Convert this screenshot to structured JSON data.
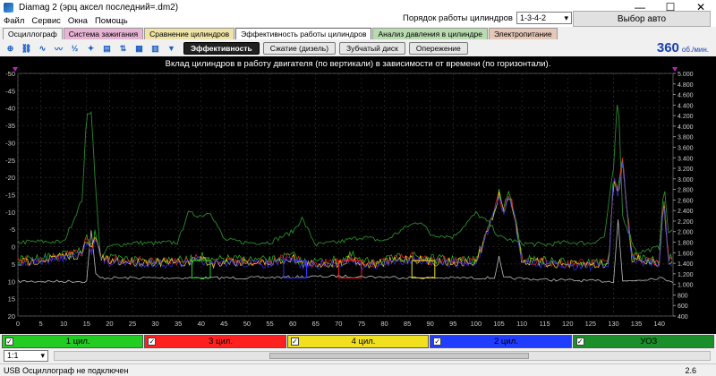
{
  "window": {
    "title": "Diamag 2 (эрц аксел последний=.dm2)",
    "minimize": "—",
    "maximize": "☐",
    "close": "✕"
  },
  "menu": [
    "Файл",
    "Сервис",
    "Окна",
    "Помощь"
  ],
  "order": {
    "label": "Порядок работы цилиндров",
    "value": "1-3-4-2",
    "spin_value": "1"
  },
  "auto_button": "Выбор авто",
  "tabs": [
    {
      "label": "Осциллограф",
      "color": "#f3f3f3"
    },
    {
      "label": "Система зажигания",
      "color": "#e8b4d6"
    },
    {
      "label": "Сравнение цилиндров",
      "color": "#efe3a6"
    },
    {
      "label": "Эффективность работы цилиндров",
      "color": "#ffffff"
    },
    {
      "label": "Анализ давления в цилиндре",
      "color": "#b8dcb0"
    },
    {
      "label": "Электропитание",
      "color": "#e6c8b8"
    }
  ],
  "subtabs": [
    "Эффективность",
    "Сжатие (дизель)",
    "Зубчатый диск",
    "Опережение"
  ],
  "rpm": {
    "value": "360",
    "unit": "об./мин."
  },
  "chart_data": {
    "type": "line",
    "title": "Вклад цилиндров в работу двигателя (по вертикали) в зависимости от времени (по горизонтали).",
    "x_ticks": [
      "0",
      "5",
      "10",
      "15",
      "20",
      "25",
      "30",
      "35",
      "40",
      "45",
      "50",
      "55",
      "60",
      "65",
      "70",
      "75",
      "80",
      "85",
      "90",
      "95",
      "100",
      "105",
      "110",
      "115",
      "120",
      "125",
      "130",
      "135",
      "140"
    ],
    "y_left_ticks": [
      "-50",
      "-45",
      "-40",
      "-35",
      "-30",
      "-25",
      "-20",
      "-15",
      "-10",
      "-5",
      "0",
      "5",
      "10",
      "15",
      "20"
    ],
    "y_right_ticks": [
      "5.000",
      "4.800",
      "4.600",
      "4.400",
      "4.200",
      "4.000",
      "3.800",
      "3.600",
      "3.400",
      "3.200",
      "3.000",
      "2.800",
      "2.600",
      "2.400",
      "2.200",
      "2.000",
      "1.800",
      "1.600",
      "1.400",
      "1.200",
      "1.000",
      "800",
      "600",
      "400"
    ],
    "xlim": [
      0,
      143
    ],
    "ylim_left": [
      -50,
      20
    ],
    "ylim_right": [
      400,
      5000
    ],
    "grid": true,
    "colors": {
      "cyl1": "#22cc22",
      "cyl2": "#ff2020",
      "cyl3": "#f0e020",
      "cyl4": "#3030ff",
      "rpm": "#2a8a2a",
      "ignition": "#bbbbbb",
      "background": "#000000"
    },
    "series_rpm_right_axis": [
      [
        0,
        1800
      ],
      [
        5,
        1810
      ],
      [
        10,
        1800
      ],
      [
        14,
        2600
      ],
      [
        15,
        4200
      ],
      [
        16,
        4300
      ],
      [
        17,
        2800
      ],
      [
        18,
        1500
      ],
      [
        20,
        1720
      ],
      [
        25,
        1790
      ],
      [
        30,
        1780
      ],
      [
        35,
        1800
      ],
      [
        37,
        2350
      ],
      [
        40,
        2300
      ],
      [
        42,
        2380
      ],
      [
        45,
        1850
      ],
      [
        50,
        1790
      ],
      [
        55,
        1800
      ],
      [
        60,
        2000
      ],
      [
        62,
        2250
      ],
      [
        65,
        1750
      ],
      [
        70,
        1800
      ],
      [
        75,
        1900
      ],
      [
        80,
        1820
      ],
      [
        85,
        2100
      ],
      [
        88,
        2200
      ],
      [
        90,
        1950
      ],
      [
        95,
        1900
      ],
      [
        100,
        2350
      ],
      [
        103,
        2150
      ],
      [
        105,
        1900
      ],
      [
        110,
        1780
      ],
      [
        115,
        1750
      ],
      [
        120,
        1800
      ],
      [
        125,
        1780
      ],
      [
        128,
        1900
      ],
      [
        130,
        3200
      ],
      [
        131,
        4650
      ],
      [
        132,
        2300
      ],
      [
        135,
        1600
      ],
      [
        140,
        1700
      ],
      [
        141,
        2900
      ],
      [
        142,
        2000
      ]
    ],
    "series_ignition_left_axis": [
      [
        0,
        10
      ],
      [
        15,
        10
      ],
      [
        16,
        -5
      ],
      [
        17,
        8
      ],
      [
        18,
        9
      ],
      [
        30,
        9
      ],
      [
        50,
        9
      ],
      [
        70,
        8.5
      ],
      [
        90,
        9
      ],
      [
        104,
        9
      ],
      [
        105,
        3
      ],
      [
        106,
        9
      ],
      [
        115,
        9.5
      ],
      [
        130,
        10
      ],
      [
        131,
        -8
      ],
      [
        132,
        10
      ],
      [
        140,
        9
      ],
      [
        143,
        10
      ]
    ],
    "cylinder_overlay": [
      [
        0,
        4.5
      ],
      [
        14,
        2
      ],
      [
        15,
        -2
      ],
      [
        16,
        1
      ],
      [
        17,
        -4
      ],
      [
        18,
        3
      ],
      [
        20,
        4
      ],
      [
        37,
        4.5
      ],
      [
        40,
        3
      ],
      [
        42,
        5
      ],
      [
        45,
        4
      ],
      [
        55,
        4.5
      ],
      [
        60,
        3
      ],
      [
        62,
        5
      ],
      [
        70,
        4.5
      ],
      [
        73,
        3
      ],
      [
        75,
        5
      ],
      [
        80,
        4.5
      ],
      [
        86,
        3
      ],
      [
        89,
        4
      ],
      [
        100,
        4.5
      ],
      [
        104,
        -10
      ],
      [
        105,
        -15
      ],
      [
        106,
        -10
      ],
      [
        107,
        -15
      ],
      [
        108,
        -12
      ],
      [
        110,
        4
      ],
      [
        120,
        5
      ],
      [
        129,
        5
      ],
      [
        130,
        -20
      ],
      [
        131,
        -15
      ],
      [
        132,
        -25
      ],
      [
        133,
        -10
      ],
      [
        134,
        3
      ],
      [
        140,
        5
      ],
      [
        141,
        -14
      ],
      [
        142,
        4
      ]
    ],
    "blocks": [
      {
        "x0": 38,
        "x1": 42,
        "y_mean": 6.5,
        "color": "cyl1"
      },
      {
        "x0": 58,
        "x1": 63,
        "y_mean": 6.5,
        "color": "cyl4"
      },
      {
        "x0": 70,
        "x1": 75,
        "y_mean": 6.5,
        "color": "cyl2"
      },
      {
        "x0": 86,
        "x1": 91,
        "y_mean": 6.5,
        "color": "cyl3"
      }
    ]
  },
  "legend": [
    {
      "label": "1 цил.",
      "color": "#22cc22"
    },
    {
      "label": "3 цил.",
      "color": "#ff2020"
    },
    {
      "label": "4 цил.",
      "color": "#f0e020"
    },
    {
      "label": "2 цил.",
      "color": "#1f3cff"
    },
    {
      "label": "УОЗ",
      "color": "#1a8f2a"
    }
  ],
  "zoom": "1:1",
  "status": {
    "text": "USB Осциллограф не подключен",
    "version": "2.6"
  }
}
